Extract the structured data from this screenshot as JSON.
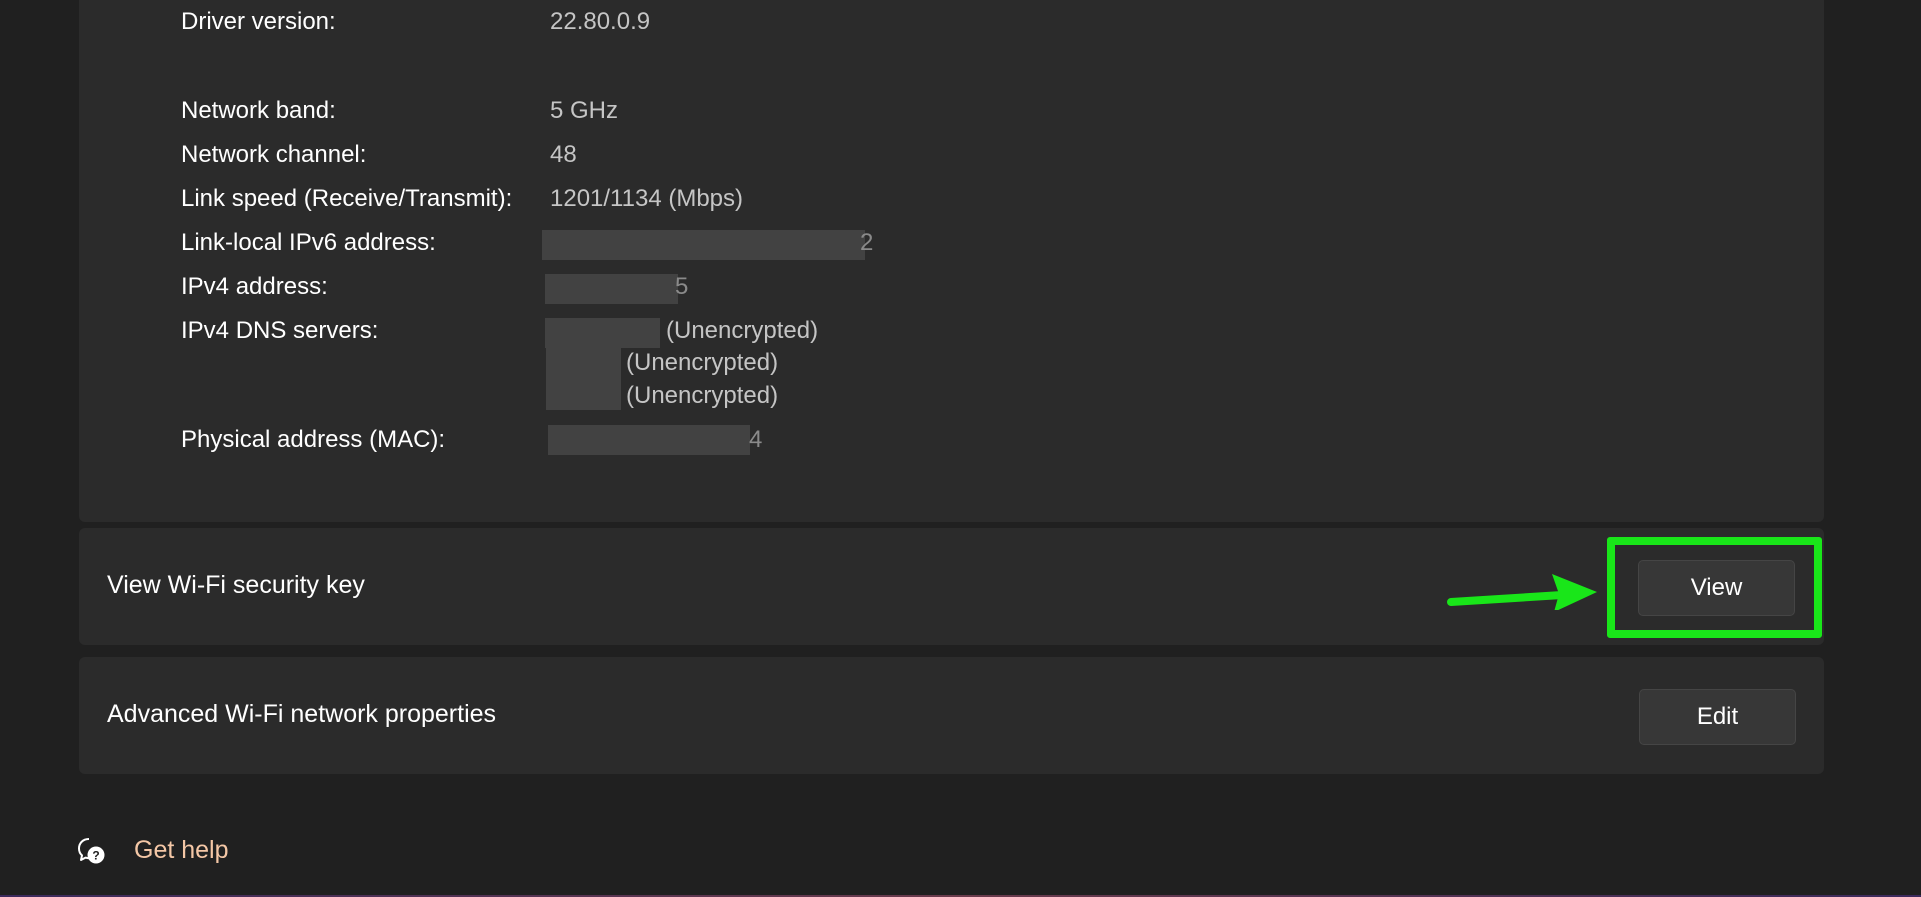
{
  "properties": {
    "driver_version": {
      "label": "Driver version:",
      "value": "22.80.0.9"
    },
    "network_band": {
      "label": "Network band:",
      "value": "5 GHz"
    },
    "network_channel": {
      "label": "Network channel:",
      "value": "48"
    },
    "link_speed": {
      "label": "Link speed (Receive/Transmit):",
      "value": "1201/1134 (Mbps)"
    },
    "ipv6": {
      "label": "Link-local IPv6 address:",
      "visible_tail": "2"
    },
    "ipv4": {
      "label": "IPv4 address:",
      "visible_tail": "5"
    },
    "dns": {
      "label": "IPv4 DNS servers:",
      "entries": [
        "(Unencrypted)",
        "(Unencrypted)",
        "(Unencrypted)"
      ]
    },
    "mac": {
      "label": "Physical address (MAC):",
      "visible_tail": "4"
    }
  },
  "security_key": {
    "label": "View Wi-Fi security key",
    "button": "View"
  },
  "advanced": {
    "label": "Advanced Wi-Fi network properties",
    "button": "Edit"
  },
  "help": {
    "label": "Get help"
  },
  "colors": {
    "background": "#202020",
    "card": "#2b2b2b",
    "highlight": "#19e619",
    "help_link": "#f4c7a6"
  }
}
